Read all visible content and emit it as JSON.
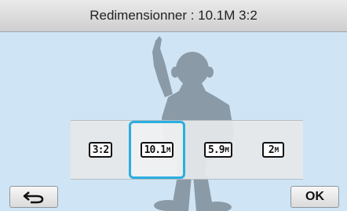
{
  "header": {
    "title": "Redimensionner : 10.1M 3:2"
  },
  "size_options": [
    {
      "main": "3:2",
      "unit": ""
    },
    {
      "main": "10.1",
      "unit": "M"
    },
    {
      "main": "5.9",
      "unit": "M"
    },
    {
      "main": "2",
      "unit": "M"
    }
  ],
  "selected_option": "10.1M",
  "footer": {
    "back_icon": "return-arrow-icon",
    "ok_label": "OK"
  },
  "colors": {
    "background": "#cfe5f5",
    "selection": "#2aaee0",
    "silhouette": "#8a9aa6"
  }
}
